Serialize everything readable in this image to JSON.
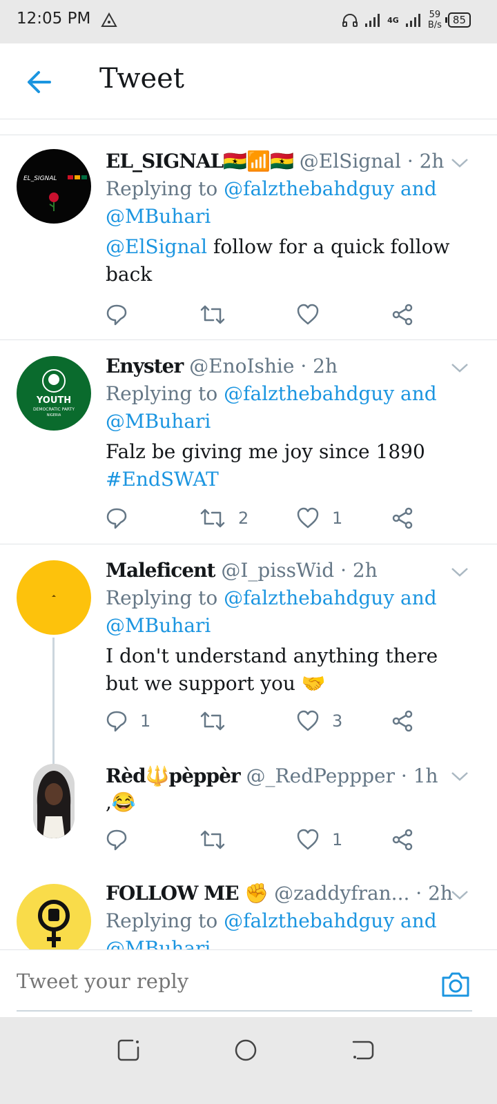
{
  "status_bar": {
    "time": "12:05 PM",
    "network": "4G",
    "speed_value": "59",
    "speed_unit": "B/s",
    "battery": "85"
  },
  "header": {
    "title": "Tweet",
    "back_icon": "arrow-left-icon",
    "accent": "#1b95e0"
  },
  "tweets": [
    {
      "name": "EL_SIGNAL🇬🇭📶🇬🇭",
      "handle": "@ElSignal",
      "time": "· 2h",
      "replying_prefix": "Replying to ",
      "replying_to_1": "@falzthebahdguy and",
      "replying_to_2": "@MBuhari",
      "text_link": "@ElSignal",
      "text": " follow for a quick follow back",
      "replies": "",
      "retweets": "",
      "likes": "",
      "avatar_label": "EL_SIGNAL"
    },
    {
      "name": "Enyster",
      "handle": "@EnoIshie",
      "time": "· 2h",
      "replying_prefix": "Replying to ",
      "replying_to_1": "@falzthebahdguy and",
      "replying_to_2": "@MBuhari",
      "text": "Falz be giving me joy since 1890",
      "hashtag": "#EndSWAT",
      "replies": "",
      "retweets": "2",
      "likes": "1",
      "avatar_title": "YOUTH",
      "avatar_sub": "DEMOCRATIC PARTY",
      "avatar_sub2": "NIGERIA"
    },
    {
      "name": "Maleficent",
      "handle": "@I_pissWid",
      "time": "· 2h",
      "replying_prefix": "Replying to ",
      "replying_to_1": "@falzthebahdguy and",
      "replying_to_2": "@MBuhari",
      "text": "I don't understand anything there but we support you 🤝",
      "replies": "1",
      "retweets": "",
      "likes": "3"
    },
    {
      "name": "Rèd🔱pèppèr",
      "handle": "@_RedPeppper",
      "time": "· 1h",
      "text": ",😂",
      "replies": "",
      "retweets": "",
      "likes": "1"
    },
    {
      "name": "FOLLOW ME ✊",
      "handle": "@zaddyfran...",
      "time": "· 2h",
      "replying_prefix": "Replying to ",
      "replying_to_1": "@falzthebahdguy and",
      "replying_to_2": "@MBuhari"
    }
  ],
  "reply_bar": {
    "placeholder": "Tweet your reply",
    "camera_icon": "camera-icon"
  },
  "nav_bar": {
    "icons": [
      "recent-apps-icon",
      "home-icon",
      "back-icon"
    ]
  }
}
